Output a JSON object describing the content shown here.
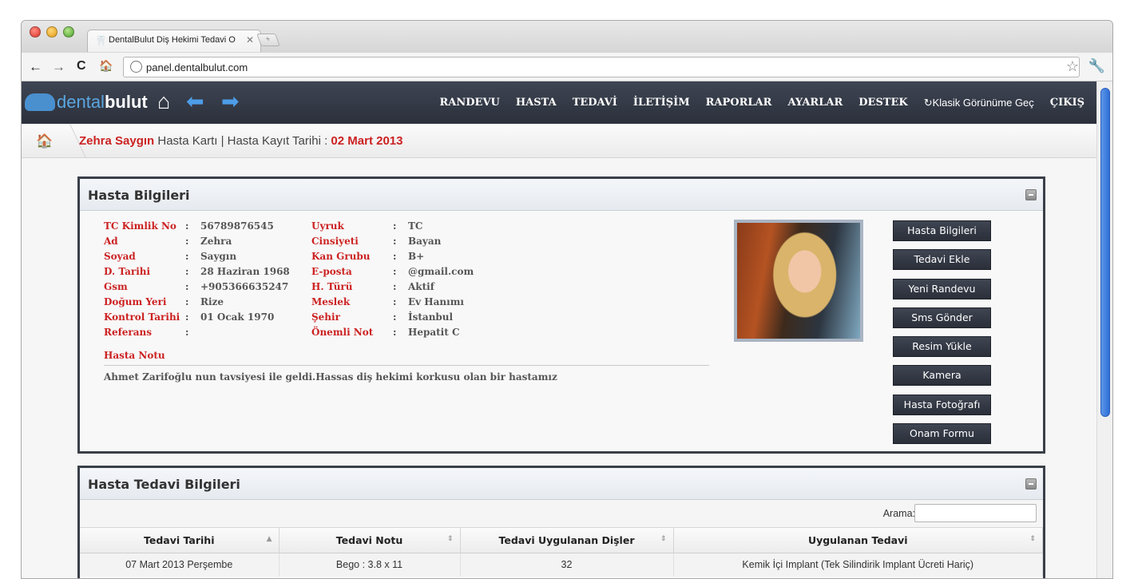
{
  "browser": {
    "tab_title": "DentalBulut Diş Hekimi Tedavi O",
    "tab_close": "✕",
    "newtab_label": "+",
    "url": "panel.dentalbulut.com",
    "back": "←",
    "forward": "→",
    "reload": "C",
    "home": "🏠",
    "star": "☆",
    "wrench": "🔧"
  },
  "nav": {
    "logo_light": "dental",
    "logo_bold": "bulut",
    "menu": [
      "RANDEVU",
      "HASTA",
      "TEDAVİ",
      "İLETİŞİM",
      "RAPORLAR",
      "AYARLAR",
      "DESTEK"
    ],
    "classic_view": "Klasik Görünüme Geç",
    "classic_icon": "↻",
    "logout": "ÇIKIŞ"
  },
  "breadcrumb": {
    "patient_name": "Zehra Saygın",
    "card_label": " Hasta Kartı | Hasta Kayıt Tarihi : ",
    "register_date": "02 Mart 2013"
  },
  "patient_panel": {
    "title": "Hasta Bilgileri",
    "left_fields": [
      {
        "label": "TC Kimlik No",
        "value": "56789876545"
      },
      {
        "label": "Ad",
        "value": "Zehra"
      },
      {
        "label": "Soyad",
        "value": "Saygın"
      },
      {
        "label": "D. Tarihi",
        "value": "28 Haziran 1968"
      },
      {
        "label": "Gsm",
        "value": "+905366635247"
      },
      {
        "label": "Doğum Yeri",
        "value": "Rize"
      },
      {
        "label": "Kontrol Tarihi",
        "value": "01 Ocak 1970"
      },
      {
        "label": "Referans",
        "value": ""
      }
    ],
    "right_fields": [
      {
        "label": "Uyruk",
        "value": "TC"
      },
      {
        "label": "Cinsiyeti",
        "value": "Bayan"
      },
      {
        "label": "Kan Grubu",
        "value": "B+"
      },
      {
        "label": "E-posta",
        "value": "@gmail.com"
      },
      {
        "label": "H. Türü",
        "value": "Aktif"
      },
      {
        "label": "Meslek",
        "value": "Ev Hanımı"
      },
      {
        "label": "Şehir",
        "value": "İstanbul"
      },
      {
        "label": "Önemli Not",
        "value": "Hepatit C"
      }
    ],
    "separator": ":",
    "note_label": "Hasta Notu",
    "note_text": "Ahmet Zarifoğlu nun tavsiyesi ile geldi.Hassas diş hekimi korkusu olan bir hastamız",
    "actions": [
      "Hasta Bilgileri",
      "Tedavi Ekle",
      "Yeni Randevu",
      "Sms Gönder",
      "Resim Yükle",
      "Kamera",
      "Hasta Fotoğrafı",
      "Onam Formu"
    ]
  },
  "treatment_panel": {
    "title": "Hasta Tedavi Bilgileri",
    "search_label": "Arama:",
    "columns": [
      "Tedavi Tarihi",
      "Tedavi Notu",
      "Tedavi Uygulanan Dişler",
      "Uygulanan Tedavi"
    ],
    "sort_first": "▲",
    "sort_other": "⇕",
    "rows": [
      [
        "07 Mart 2013 Perşembe",
        "Bego : 3.8 x 11",
        "32",
        "Kemik İçi Implant (Tek Silindirik Implant Ücreti Hariç)"
      ]
    ]
  }
}
